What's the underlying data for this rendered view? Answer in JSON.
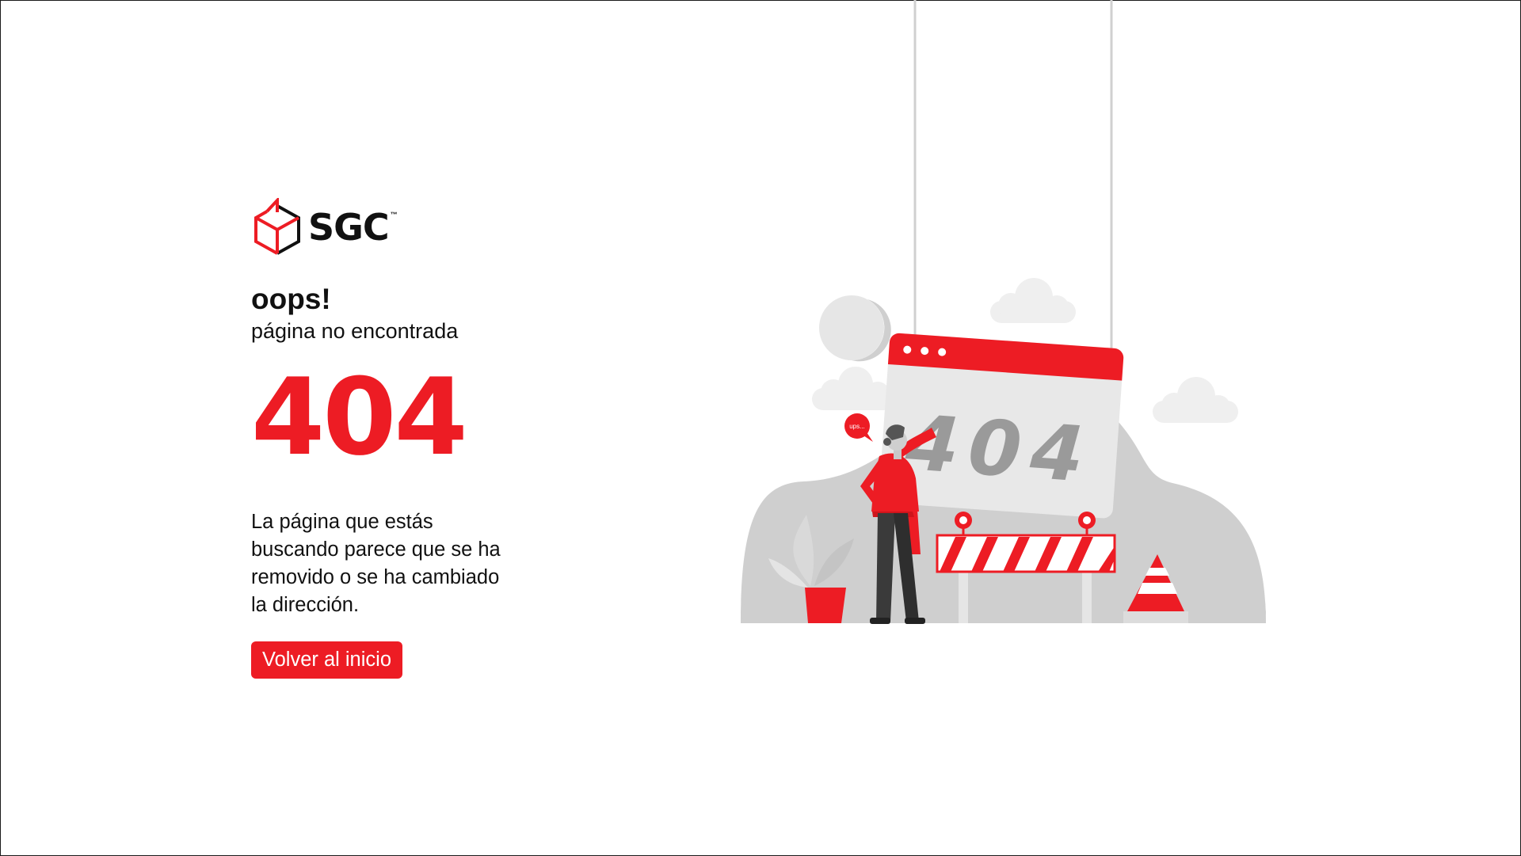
{
  "brand": {
    "name": "SGC",
    "trademark": "™"
  },
  "heading": "oops!",
  "subheading": "página no encontrada",
  "error_code": "404",
  "description": "La página que estás buscando parece que se ha removido o se ha cambiado la dirección.",
  "button": {
    "label": "Volver al inicio"
  },
  "illustration": {
    "sign_text": "404",
    "speech_bubble": "ups..."
  },
  "colors": {
    "accent": "#ed1c24",
    "text": "#111111",
    "muted_gray": "#c8c8c8"
  }
}
